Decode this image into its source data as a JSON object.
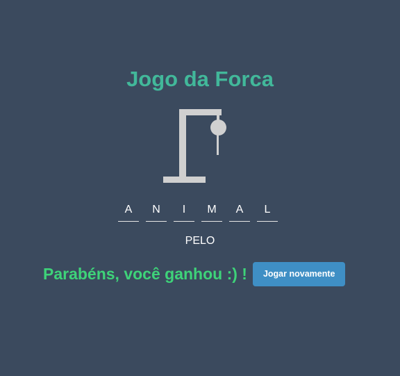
{
  "header": {
    "title": "Jogo da Forca"
  },
  "gallows": {
    "color": "#d0d0d0",
    "parts_shown": [
      "base",
      "pole",
      "beam",
      "rope",
      "head",
      "body"
    ]
  },
  "word": {
    "letters": [
      "A",
      "N",
      "I",
      "M",
      "A",
      "L"
    ]
  },
  "hint": {
    "text": "PELO"
  },
  "result": {
    "message": "Parabéns, você ganhou :) !",
    "color": "#3ed379"
  },
  "actions": {
    "play_again_label": "Jogar novamente",
    "button_color": "#3f8fc5"
  },
  "theme": {
    "background": "#3b4a5e",
    "title_color": "#42b89a"
  }
}
